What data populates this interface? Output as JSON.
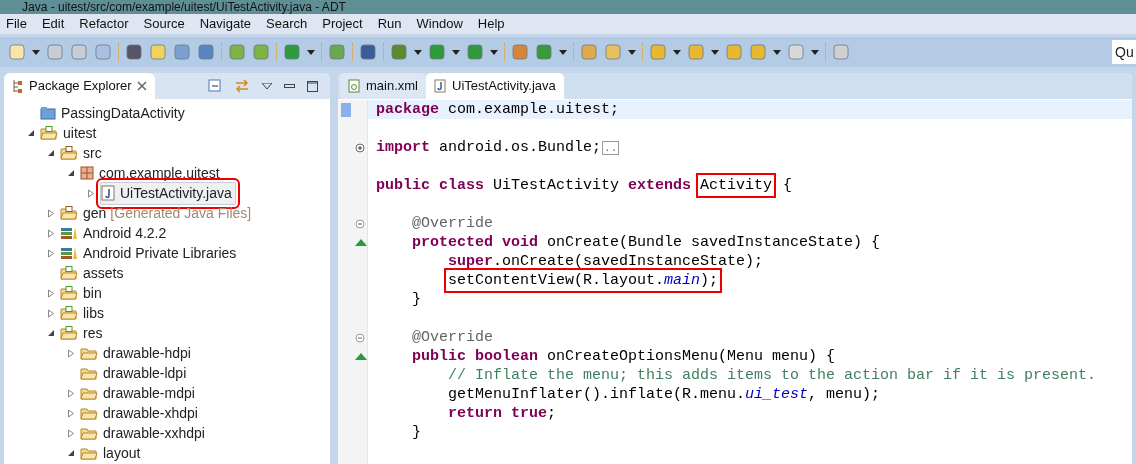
{
  "window": {
    "title": "Java - uitest/src/com/example/uitest/UiTestActivity.java - ADT"
  },
  "menu_bar": [
    "File",
    "Edit",
    "Refactor",
    "Source",
    "Navigate",
    "Search",
    "Project",
    "Run",
    "Window",
    "Help"
  ],
  "quick_access": {
    "value": "Qu"
  },
  "package_explorer": {
    "title": "Package Explorer",
    "tree": [
      {
        "label": "PassingDataActivity",
        "kind": "closed-project",
        "highlighted": false
      },
      {
        "label": "uitest",
        "kind": "project",
        "expanded": true,
        "highlighted": false,
        "children": [
          {
            "label": "src",
            "kind": "source",
            "expanded": true,
            "highlighted": false,
            "children": [
              {
                "label": "com.example.uitest",
                "kind": "package",
                "expanded": true,
                "highlighted": false,
                "children": [
                  {
                    "label": "UiTestActivity.java",
                    "kind": "java",
                    "expanded": false,
                    "highlighted": true
                  }
                ]
              }
            ]
          },
          {
            "label": "gen",
            "decoration": "[Generated Java Files]",
            "kind": "source",
            "expanded": false,
            "highlighted": false
          },
          {
            "label": "Android 4.2.2",
            "kind": "library",
            "expanded": false,
            "highlighted": false
          },
          {
            "label": "Android Private Libraries",
            "kind": "library",
            "expanded": false,
            "highlighted": false
          },
          {
            "label": "assets",
            "kind": "resource",
            "highlighted": false
          },
          {
            "label": "bin",
            "kind": "resource",
            "expanded": false,
            "highlighted": false
          },
          {
            "label": "libs",
            "kind": "resource",
            "expanded": false,
            "highlighted": false
          },
          {
            "label": "res",
            "kind": "resource",
            "expanded": true,
            "highlighted": false,
            "children": [
              {
                "label": "drawable-hdpi",
                "kind": "folder",
                "expanded": false,
                "highlighted": false
              },
              {
                "label": "drawable-ldpi",
                "kind": "folder",
                "highlighted": false
              },
              {
                "label": "drawable-mdpi",
                "kind": "folder",
                "expanded": false,
                "highlighted": false
              },
              {
                "label": "drawable-xhdpi",
                "kind": "folder",
                "expanded": false,
                "highlighted": false
              },
              {
                "label": "drawable-xxhdpi",
                "kind": "folder",
                "expanded": false,
                "highlighted": false
              },
              {
                "label": "layout",
                "kind": "folder",
                "expanded": true,
                "highlighted": false
              }
            ]
          }
        ]
      }
    ]
  },
  "editor_tabs": [
    {
      "label": "main.xml",
      "kind": "xml",
      "selected": false
    },
    {
      "label": "UiTestActivity.java",
      "kind": "java",
      "selected": true
    }
  ],
  "code": [
    {
      "kind": "code",
      "current": true,
      "tokens": [
        {
          "kind": "keyword",
          "text": "package",
          "highlighted": false
        },
        {
          "kind": "plain",
          "text": " com.example.uitest;",
          "highlighted": false
        }
      ]
    },
    {
      "kind": "blank"
    },
    {
      "kind": "code",
      "folded": true,
      "current": false,
      "tokens": [
        {
          "kind": "keyword",
          "text": "import",
          "highlighted": false
        },
        {
          "kind": "plain",
          "text": " android.os.Bundle;",
          "highlighted": false
        },
        {
          "kind": "collapsed",
          "text": "..",
          "highlighted": false
        }
      ]
    },
    {
      "kind": "blank"
    },
    {
      "kind": "code",
      "current": false,
      "tokens": [
        {
          "kind": "keyword",
          "text": "public class",
          "highlighted": false
        },
        {
          "kind": "plain",
          "text": " UiTestActivity ",
          "highlighted": false
        },
        {
          "kind": "keyword",
          "text": "extends",
          "highlighted": false
        },
        {
          "kind": "plain",
          "text": "Activity",
          "highlighted": true
        },
        {
          "kind": "plain",
          "text": " {",
          "highlighted": false
        }
      ]
    },
    {
      "kind": "blank"
    },
    {
      "kind": "code",
      "folded": false,
      "current": false,
      "tokens": [
        {
          "kind": "annotation",
          "text": "    @Override",
          "highlighted": false
        }
      ]
    },
    {
      "kind": "code",
      "override": true,
      "current": false,
      "tokens": [
        {
          "kind": "keyword",
          "text": "    protected void",
          "highlighted": false
        },
        {
          "kind": "plain",
          "text": " onCreate(Bundle savedInstanceState) {",
          "highlighted": false
        }
      ]
    },
    {
      "kind": "code",
      "current": false,
      "tokens": [
        {
          "kind": "keyword",
          "text": "        super",
          "highlighted": false
        },
        {
          "kind": "plain",
          "text": ".onCreate(savedInstanceState);",
          "highlighted": false
        }
      ]
    },
    {
      "kind": "code",
      "current": false,
      "tokens": [
        {
          "kind": "plain",
          "text": "        setContentView(R.layout.",
          "highlighted": true
        },
        {
          "kind": "field",
          "text": "main",
          "highlighted": true
        },
        {
          "kind": "plain",
          "text": ");",
          "highlighted": true
        }
      ]
    },
    {
      "kind": "code",
      "current": false,
      "tokens": [
        {
          "kind": "plain",
          "text": "    }",
          "highlighted": false
        }
      ]
    },
    {
      "kind": "blank"
    },
    {
      "kind": "code",
      "folded": false,
      "current": false,
      "tokens": [
        {
          "kind": "annotation",
          "text": "    @Override",
          "highlighted": false
        }
      ]
    },
    {
      "kind": "code",
      "override": true,
      "current": false,
      "tokens": [
        {
          "kind": "keyword",
          "text": "    public boolean",
          "highlighted": false
        },
        {
          "kind": "plain",
          "text": " onCreateOptionsMenu(Menu menu) {",
          "highlighted": false
        }
      ]
    },
    {
      "kind": "code",
      "current": false,
      "tokens": [
        {
          "kind": "comment",
          "text": "        // Inflate the menu; this adds items to the action bar if it is present.",
          "highlighted": false
        }
      ]
    },
    {
      "kind": "code",
      "current": false,
      "tokens": [
        {
          "kind": "plain",
          "text": "        getMenuInflater().inflate(R.menu.",
          "highlighted": false
        },
        {
          "kind": "field",
          "text": "ui_test",
          "highlighted": false
        },
        {
          "kind": "plain",
          "text": ", menu);",
          "highlighted": false
        }
      ]
    },
    {
      "kind": "code",
      "current": false,
      "tokens": [
        {
          "kind": "keyword",
          "text": "        return true",
          "highlighted": false
        },
        {
          "kind": "plain",
          "text": ";",
          "highlighted": false
        }
      ]
    },
    {
      "kind": "code",
      "current": false,
      "tokens": [
        {
          "kind": "plain",
          "text": "    }",
          "highlighted": false
        }
      ]
    }
  ]
}
